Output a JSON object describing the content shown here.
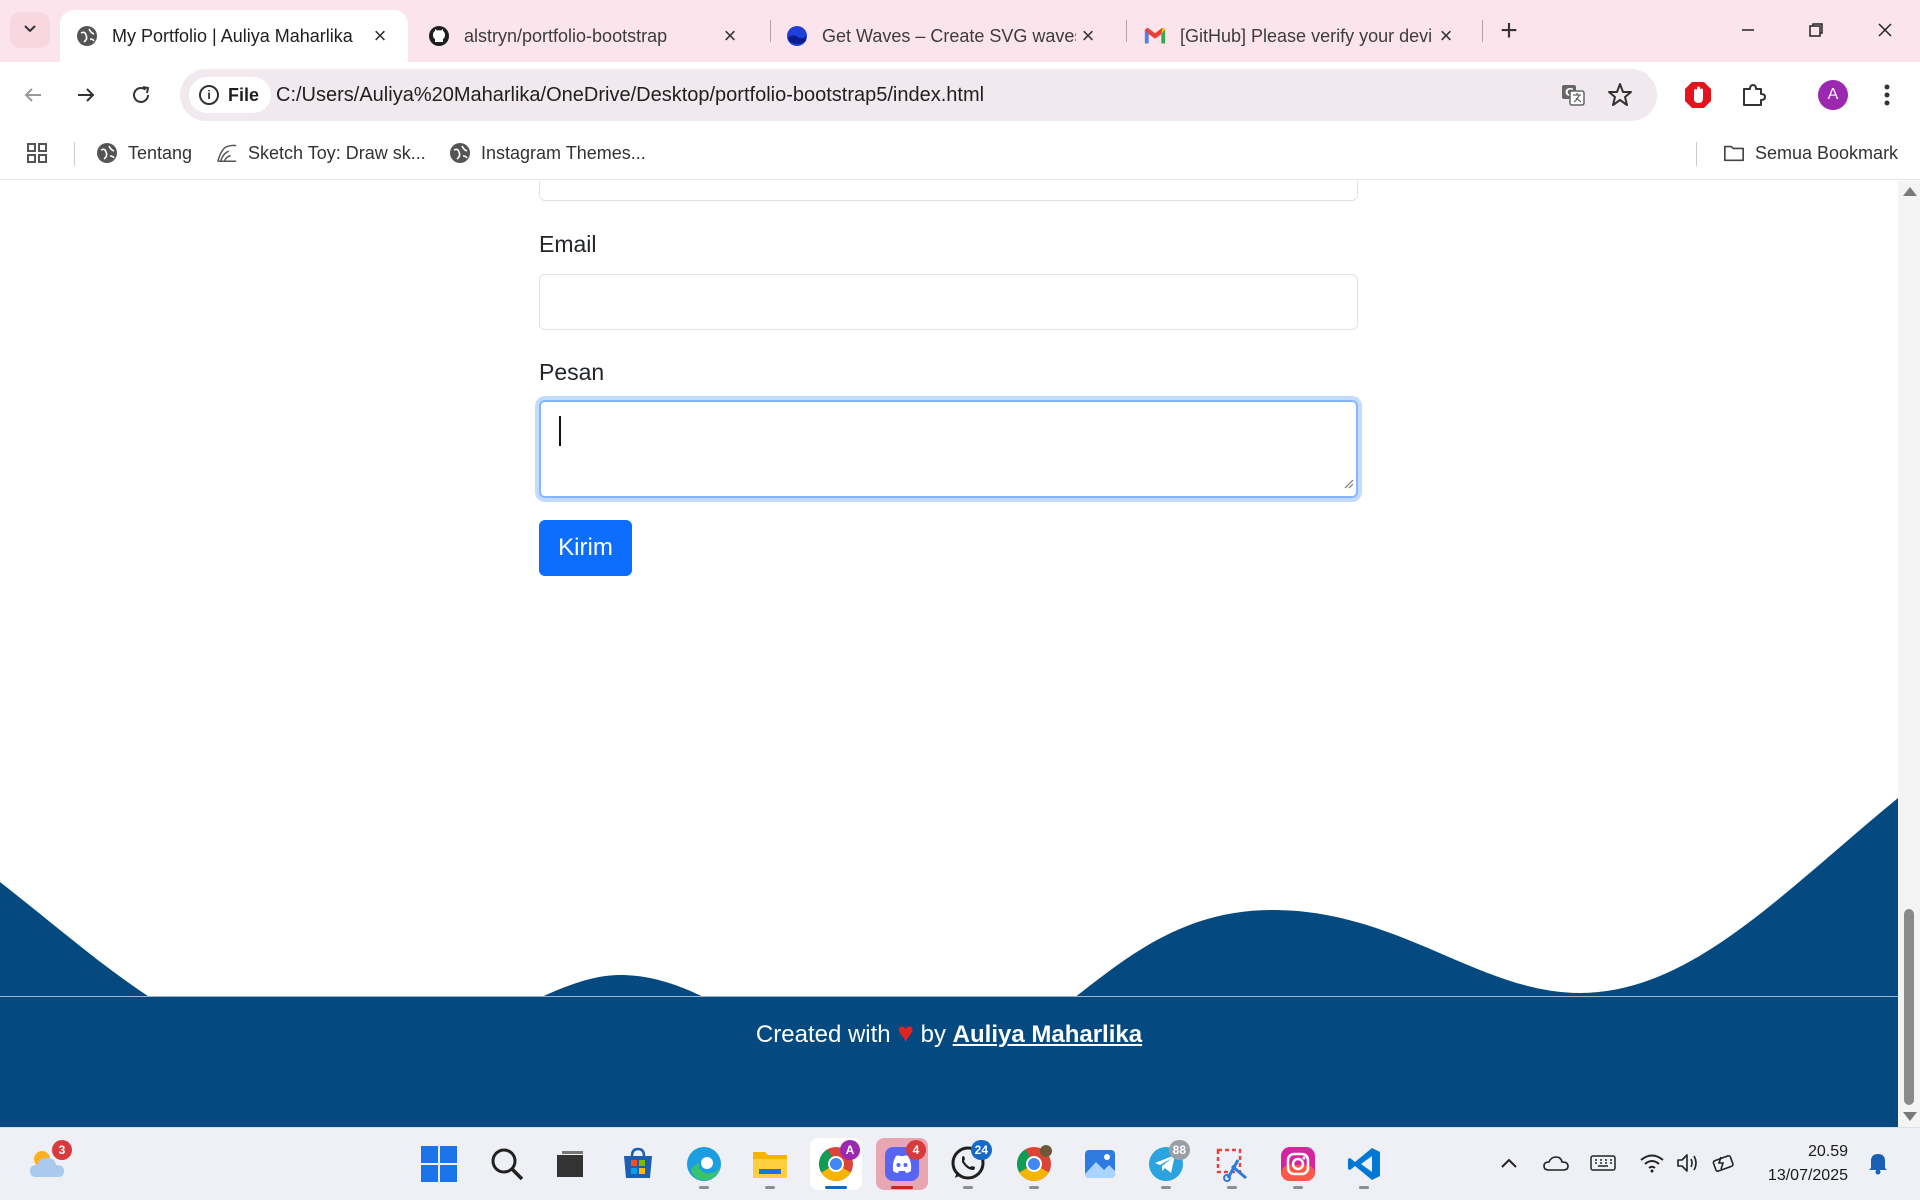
{
  "browser": {
    "tabs": [
      {
        "title": "My Portfolio | Auliya Maharlika",
        "icon": "globe-icon",
        "active": true
      },
      {
        "title": "alstryn/portfolio-bootstrap",
        "icon": "github-icon",
        "active": false
      },
      {
        "title": "Get Waves – Create SVG waves",
        "icon": "getwaves-icon",
        "active": false
      },
      {
        "title": "[GitHub] Please verify your devi",
        "icon": "gmail-icon",
        "active": false
      }
    ],
    "address_chip": "File",
    "url": "C:/Users/Auliya%20Maharlika/OneDrive/Desktop/portfolio-bootstrap5/index.html",
    "profile_initial": "A",
    "bookmarks": [
      {
        "label": "Tentang",
        "icon": "globe-icon"
      },
      {
        "label": "Sketch Toy: Draw sk...",
        "icon": "sketch-icon"
      },
      {
        "label": "Instagram Themes...",
        "icon": "globe-icon"
      }
    ],
    "all_bookmarks_label": "Semua Bookmark"
  },
  "page": {
    "form": {
      "email_label": "Email",
      "email_value": "",
      "message_label": "Pesan",
      "message_value": "",
      "submit_label": "Kirim"
    },
    "footer": {
      "prefix": "Created with",
      "mid": "by",
      "author": "Auliya Maharlika"
    },
    "colors": {
      "wave": "#044a80",
      "primary_button": "#0d6efd",
      "focus_ring": "#86b7fe"
    }
  },
  "taskbar": {
    "weather_badge": "3",
    "chrome_profile_badge": "A",
    "discord_badge": "4",
    "whatsapp_badge": "24",
    "telegram_badge": "88",
    "time": "20.59",
    "date": "13/07/2025"
  }
}
